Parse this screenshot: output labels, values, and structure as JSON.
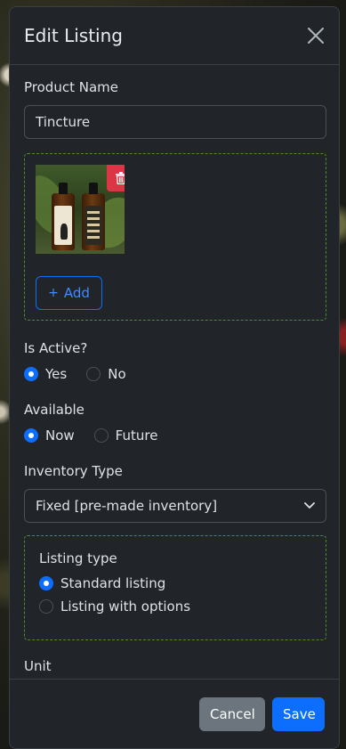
{
  "modal": {
    "title": "Edit Listing"
  },
  "product_name": {
    "label": "Product Name",
    "value": "Tincture"
  },
  "images": {
    "add_label": "Add"
  },
  "is_active": {
    "label": "Is Active?",
    "options": [
      "Yes",
      "No"
    ],
    "selected": "Yes"
  },
  "available": {
    "label": "Available",
    "options": [
      "Now",
      "Future"
    ],
    "selected": "Now"
  },
  "inventory_type": {
    "label": "Inventory Type",
    "selected": "Fixed [pre-made inventory]"
  },
  "listing_type": {
    "label": "Listing type",
    "options": [
      "Standard listing",
      "Listing with options"
    ],
    "selected": "Standard listing"
  },
  "unit": {
    "label": "Unit"
  },
  "footer": {
    "cancel_label": "Cancel",
    "save_label": "Save"
  },
  "colors": {
    "primary": "#0d6efd",
    "danger": "#dc3545",
    "secondary": "#6c757d",
    "modal_bg": "#212529",
    "dashed_border": "#4e8a2e"
  },
  "icons": [
    "close-icon",
    "trash-icon",
    "plus-icon",
    "chevron-down-icon"
  ]
}
